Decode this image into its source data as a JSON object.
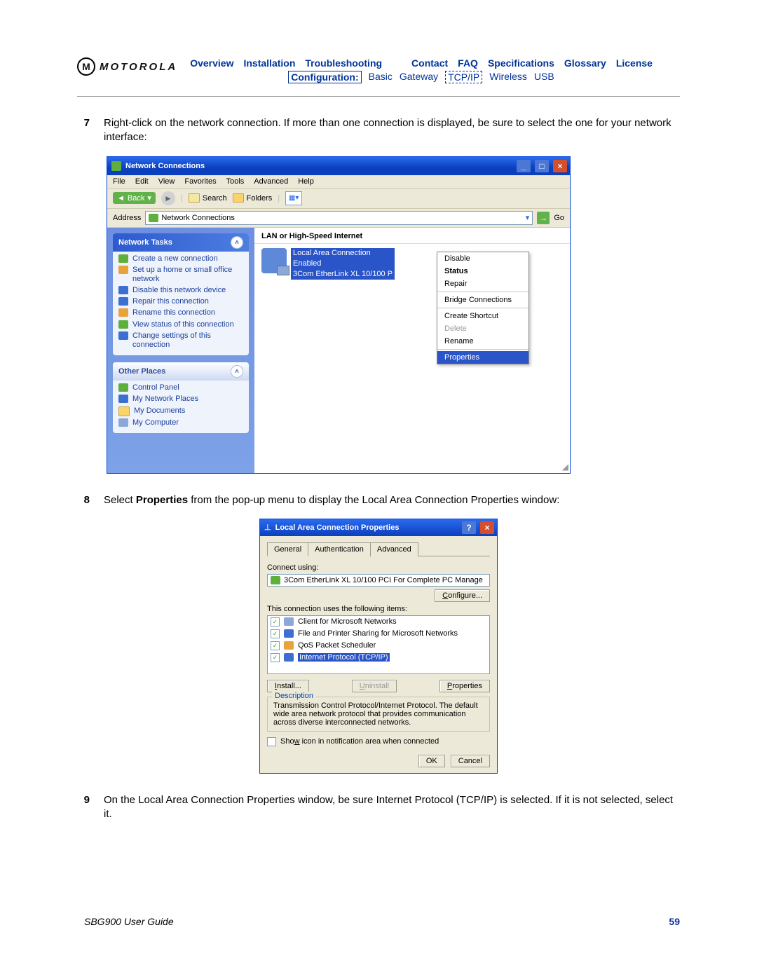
{
  "header": {
    "brand": "MOTOROLA",
    "nav1": [
      "Overview",
      "Installation",
      "Troubleshooting",
      "Contact",
      "FAQ",
      "Specifications",
      "Glossary",
      "License"
    ],
    "nav2": {
      "label": "Configuration:",
      "items": [
        "Basic",
        "Gateway",
        "TCP/IP",
        "Wireless",
        "USB"
      ],
      "boxed": "Configuration:",
      "dashed": "TCP/IP"
    }
  },
  "steps": {
    "s7": {
      "num": "7",
      "text": "Right-click on the network connection. If more than one connection is displayed, be sure to select the one for your network interface:"
    },
    "s8": {
      "num": "8",
      "text_pre": "Select ",
      "bold": "Properties",
      "text_post": " from the pop-up menu to display the Local Area Connection Properties window:"
    },
    "s9": {
      "num": "9",
      "text": "On the Local Area Connection Properties window, be sure Internet Protocol (TCP/IP) is selected. If it is not selected, select it."
    }
  },
  "fig1": {
    "title": "Network Connections",
    "menu": [
      "File",
      "Edit",
      "View",
      "Favorites",
      "Tools",
      "Advanced",
      "Help"
    ],
    "toolbar": {
      "back": "Back",
      "search": "Search",
      "folders": "Folders"
    },
    "address": {
      "label": "Address",
      "value": "Network Connections",
      "go": "Go"
    },
    "side": {
      "tasks_head": "Network Tasks",
      "tasks": [
        "Create a new connection",
        "Set up a home or small office network",
        "Disable this network device",
        "Repair this connection",
        "Rename this connection",
        "View status of this connection",
        "Change settings of this connection"
      ],
      "places_head": "Other Places",
      "places": [
        "Control Panel",
        "My Network Places",
        "My Documents",
        "My Computer"
      ]
    },
    "main": {
      "heading": "LAN or High-Speed Internet",
      "conn": {
        "name": "Local Area Connection",
        "status": "Enabled",
        "device": "3Com EtherLink XL 10/100 P"
      },
      "ctx": [
        "Disable",
        "Status",
        "Repair",
        "Bridge Connections",
        "Create Shortcut",
        "Delete",
        "Rename",
        "Properties"
      ],
      "ctx_bold": "Status",
      "ctx_disabled": "Delete",
      "ctx_selected": "Properties"
    }
  },
  "fig2": {
    "title": "Local Area Connection Properties",
    "tabs": [
      "General",
      "Authentication",
      "Advanced"
    ],
    "connect_label": "Connect using:",
    "adapter": "3Com EtherLink XL 10/100 PCI For Complete PC Manage",
    "configure": "Configure...",
    "uses_label": "This connection uses the following items:",
    "items": [
      "Client for Microsoft Networks",
      "File and Printer Sharing for Microsoft Networks",
      "QoS Packet Scheduler",
      "Internet Protocol (TCP/IP)"
    ],
    "item_selected": "Internet Protocol (TCP/IP)",
    "btns": {
      "install": "Install...",
      "uninstall": "Uninstall",
      "props": "Properties"
    },
    "desc": {
      "label": "Description",
      "text": "Transmission Control Protocol/Internet Protocol. The default wide area network protocol that provides communication across diverse interconnected networks."
    },
    "show_icon": "Show icon in notification area when connected",
    "footer": {
      "ok": "OK",
      "cancel": "Cancel"
    }
  },
  "footer": {
    "left": "SBG900 User Guide",
    "right": "59"
  }
}
